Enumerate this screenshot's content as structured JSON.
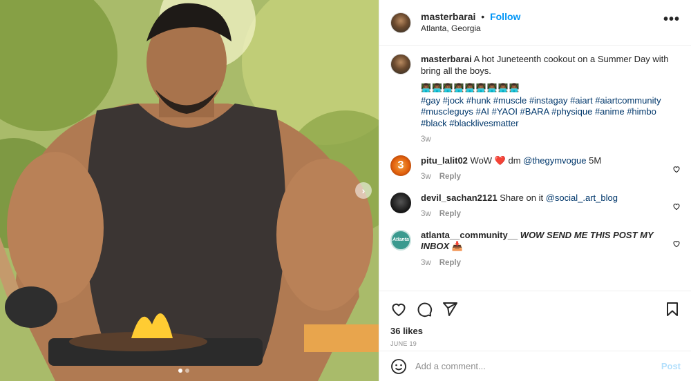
{
  "post": {
    "username": "masterbarai",
    "separator": "•",
    "follow_label": "Follow",
    "location": "Atlanta, Georgia",
    "more_label": "•••",
    "carousel_next": "›"
  },
  "caption": {
    "username": "masterbarai",
    "text": "A hot Juneteenth cookout on a Summer Day with bring all the boys.",
    "emoji_line": "👨🏾‍💻👨🏾‍💻👨🏾‍💻👨🏾‍💻👨🏾‍💻👨🏾‍💻👨🏾‍💻👨🏾‍💻👨🏾‍💻",
    "hashtags": "#gay #jock #hunk #muscle #instagay #aiart #aiartcommunity #muscleguys #AI #YAOI #BARA #physique #anime #himbo #black #blacklivesmatter",
    "time": "3w"
  },
  "comments": [
    {
      "username": "pitu_lalit02",
      "avatar_text": "3",
      "text_before": "WoW",
      "emoji": "❤️",
      "text_after": "dm",
      "mention": "@thegymvogue",
      "text_end": "5M",
      "time": "3w",
      "reply": "Reply"
    },
    {
      "username": "devil_sachan2121",
      "text": "Share on it",
      "mention": "@social_.art_blog",
      "time": "3w",
      "reply": "Reply"
    },
    {
      "username": "atlanta__community__",
      "avatar_text": "Atlanta",
      "text": "WOW SEND ME THIS POST MY INBOX",
      "emoji": "📥",
      "time": "3w",
      "reply": "Reply"
    }
  ],
  "actions": {
    "likes": "36 likes",
    "date": "JUNE 19"
  },
  "composer": {
    "placeholder": "Add a comment...",
    "post_label": "Post"
  },
  "icons": [
    "heart-icon",
    "comment-icon",
    "share-icon",
    "bookmark-icon",
    "emoji-icon",
    "more-icon",
    "chevron-right-icon"
  ]
}
